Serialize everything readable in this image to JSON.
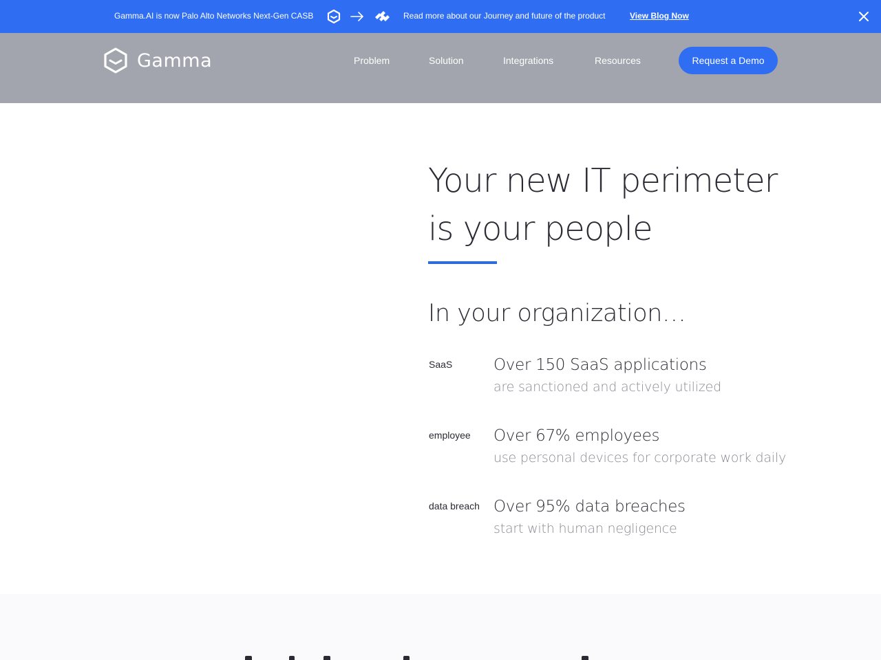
{
  "announcement": {
    "text": "Gamma.AI is now Palo Alto Networks Next-Gen CASB",
    "icons": [
      "gamma-logo-icon",
      "arrow-right-icon",
      "palo-alto-logo-icon"
    ],
    "journey_text": "Read more about our Journey and future of the product",
    "blog_link": "View Blog Now",
    "close_icon": "close-icon",
    "background": "#2f6df3"
  },
  "header": {
    "logo_text": "Gamma",
    "nav": [
      {
        "label": "Problem"
      },
      {
        "label": "Solution"
      },
      {
        "label": "Integrations"
      },
      {
        "label": "Resources"
      }
    ],
    "cta": "Request a Demo",
    "background": "#a2a5ae"
  },
  "hero": {
    "title_line1": "Your new IT perimeter",
    "title_line2": "is your people",
    "accent_color": "#2d6cd9",
    "org_heading": "In your organization…",
    "stats": [
      {
        "img_alt": "SaaS",
        "main": "Over 150 SaaS applications",
        "sub": "are sanctioned and actively utilized"
      },
      {
        "img_alt": "employee",
        "main": "Over 67% employees",
        "sub": "use personal devices for corporate work daily"
      },
      {
        "img_alt": "data breach",
        "main": "Over 95% data breaches",
        "sub": "start with human negligence"
      }
    ]
  }
}
